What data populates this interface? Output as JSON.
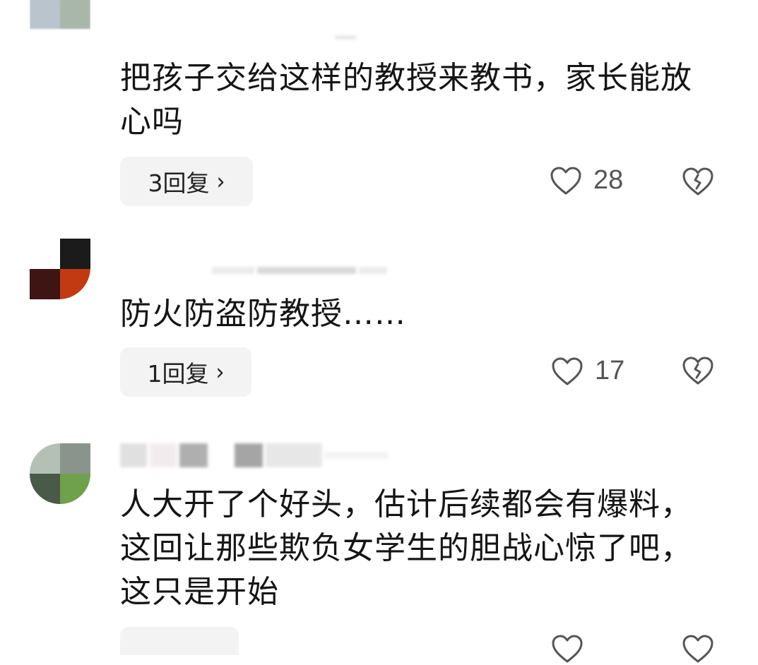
{
  "comments": [
    {
      "text": "把孩子交给这样的教授来教书，家长能放心吗",
      "replies": "3回复",
      "chevron": "›",
      "likes": "28"
    },
    {
      "text": "防火防盗防教授……",
      "replies": "1回复",
      "chevron": "›",
      "likes": "17"
    },
    {
      "text": "人大开了个好头，估计后续都会有爆料，这回让那些欺负女学生的胆战心惊了吧，这只是开始",
      "replies": "",
      "chevron": "",
      "likes": ""
    }
  ],
  "icons": {
    "like": "heart-outline-icon",
    "dislike": "broken-heart-icon"
  },
  "colors": {
    "pill_background": "#f3f3f3",
    "icon_stroke": "#555555"
  }
}
